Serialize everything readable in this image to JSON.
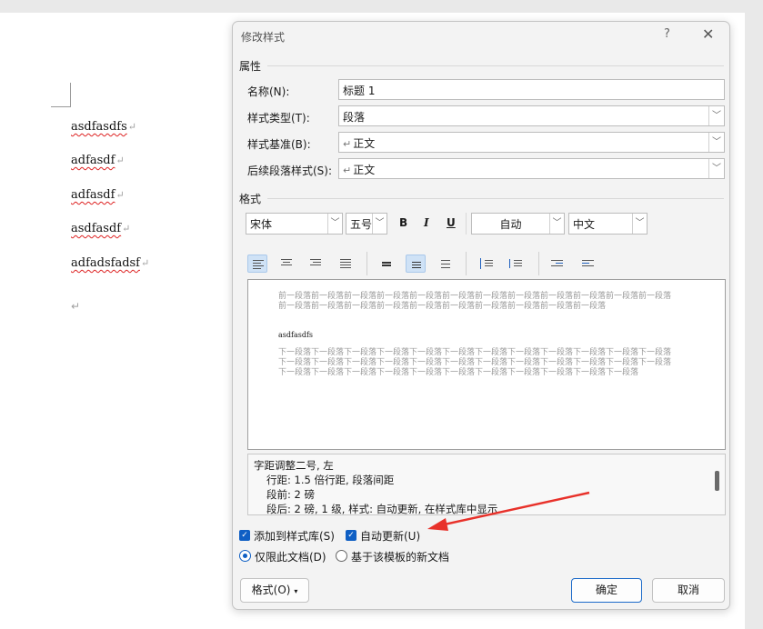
{
  "document": {
    "lines": [
      "asdfasdfs",
      "adfasdf",
      "adfasdf",
      "asdfasdf",
      "adfadsfadsf"
    ],
    "pilcrow": "↵"
  },
  "dialog": {
    "title": "修改样式",
    "help": "?",
    "close": "✕",
    "properties": {
      "heading": "属性",
      "name_label": "名称(N):",
      "name_value": "标题 1",
      "type_label": "样式类型(T):",
      "type_value": "段落",
      "based_label": "样式基准(B):",
      "based_value": "正文",
      "next_label": "后续段落样式(S):",
      "next_value": "正文"
    },
    "format": {
      "heading": "格式",
      "font": "宋体",
      "size": "五号",
      "bold": "B",
      "italic": "I",
      "underline": "U",
      "color": "自动",
      "script": "中文"
    },
    "preview": {
      "prev_para": "前一段落前一段落前一段落前一段落前一段落前一段落前一段落前一段落前一段落前一段落前一段落前一段落前一段落前一段落前一段落前一段落前一段落前一段落前一段落前一段落前一段落前一段落",
      "sample": "asdfasdfs",
      "next_para": "下一段落下一段落下一段落下一段落下一段落下一段落下一段落下一段落下一段落下一段落下一段落下一段落下一段落下一段落下一段落下一段落下一段落下一段落下一段落下一段落下一段落下一段落下一段落下一段落下一段落下一段落下一段落下一段落下一段落下一段落下一段落下一段落下一段落下一段落下一段落"
    },
    "description": {
      "line1": "字距调整二号, 左",
      "line2": "行距: 1.5 倍行距, 段落间距",
      "line3": "段前: 2 磅",
      "line4": "段后: 2 磅, 1 级, 样式: 自动更新, 在样式库中显示"
    },
    "options": {
      "add_to_gallery": "添加到样式库(S)",
      "auto_update": "自动更新(U)",
      "only_this_doc": "仅限此文档(D)",
      "new_docs_template": "基于该模板的新文档"
    },
    "buttons": {
      "format": "格式(O)",
      "ok": "确定",
      "cancel": "取消"
    },
    "colors": {
      "accent": "#0f5fc4",
      "annotation_arrow": "#e8312a"
    }
  }
}
